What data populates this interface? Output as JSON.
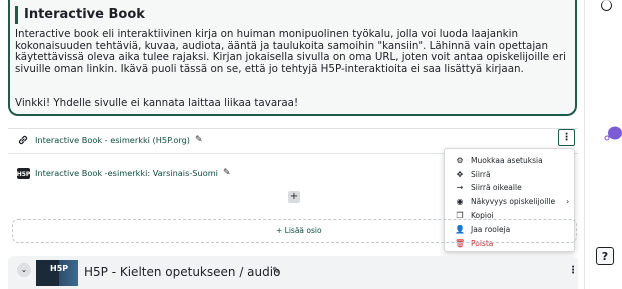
{
  "infobox": {
    "title": "Interactive Book",
    "paragraph": "Interactive book eli interaktiivinen kirja on huiman monipuolinen työkalu, jolla voi luoda laajankin kokonaisuuden tehtäviä, kuvaa, audiota, ääntä ja taulukoita samoihin \"kansiin\". Lähinnä vain opettajan käytettävissä oleva aika tulee rajaksi.  Kirjan jokaisella sivulla on oma URL, joten voit antaa opiskelijoille eri sivuille oman linkin. Ikävä puoli tässä on se, että jo tehtyjä H5P-interaktioita ei saa lisättyä kirjaan.",
    "tip": "Vinkki! Yhdelle sivulle ei kannata laittaa liikaa tavaraa!"
  },
  "activities": [
    {
      "label": "Interactive Book - esimerkki (H5P.org)",
      "icon": "link-icon"
    },
    {
      "label": "Interactive Book -esimerkki: Varsinais-Suomi",
      "icon": "h5p-icon"
    }
  ],
  "menu": {
    "items": [
      {
        "label": "Muokkaa asetuksia",
        "icon": "gear-icon"
      },
      {
        "label": "Siirrä",
        "icon": "move-icon"
      },
      {
        "label": "Siirrä oikealle",
        "icon": "arrow-right-icon"
      },
      {
        "label": "Näkyvyys opiskelijoille",
        "icon": "eye-icon"
      },
      {
        "label": "Kopioi",
        "icon": "copy-icon"
      },
      {
        "label": "Jaa rooleja",
        "icon": "user-icon"
      },
      {
        "label": "Poista",
        "icon": "trash-icon"
      }
    ],
    "danger_color": "#c4242b"
  },
  "add_activity": "+",
  "add_section": "+ Lisää osio",
  "section": {
    "thumb_text": "H5P",
    "title": "H5P - Kielten opetukseen / audio"
  },
  "help": "?",
  "colors": {
    "accent": "#1f5a4b",
    "link": "#0f4b3e",
    "chat": "#7b5cd6"
  }
}
